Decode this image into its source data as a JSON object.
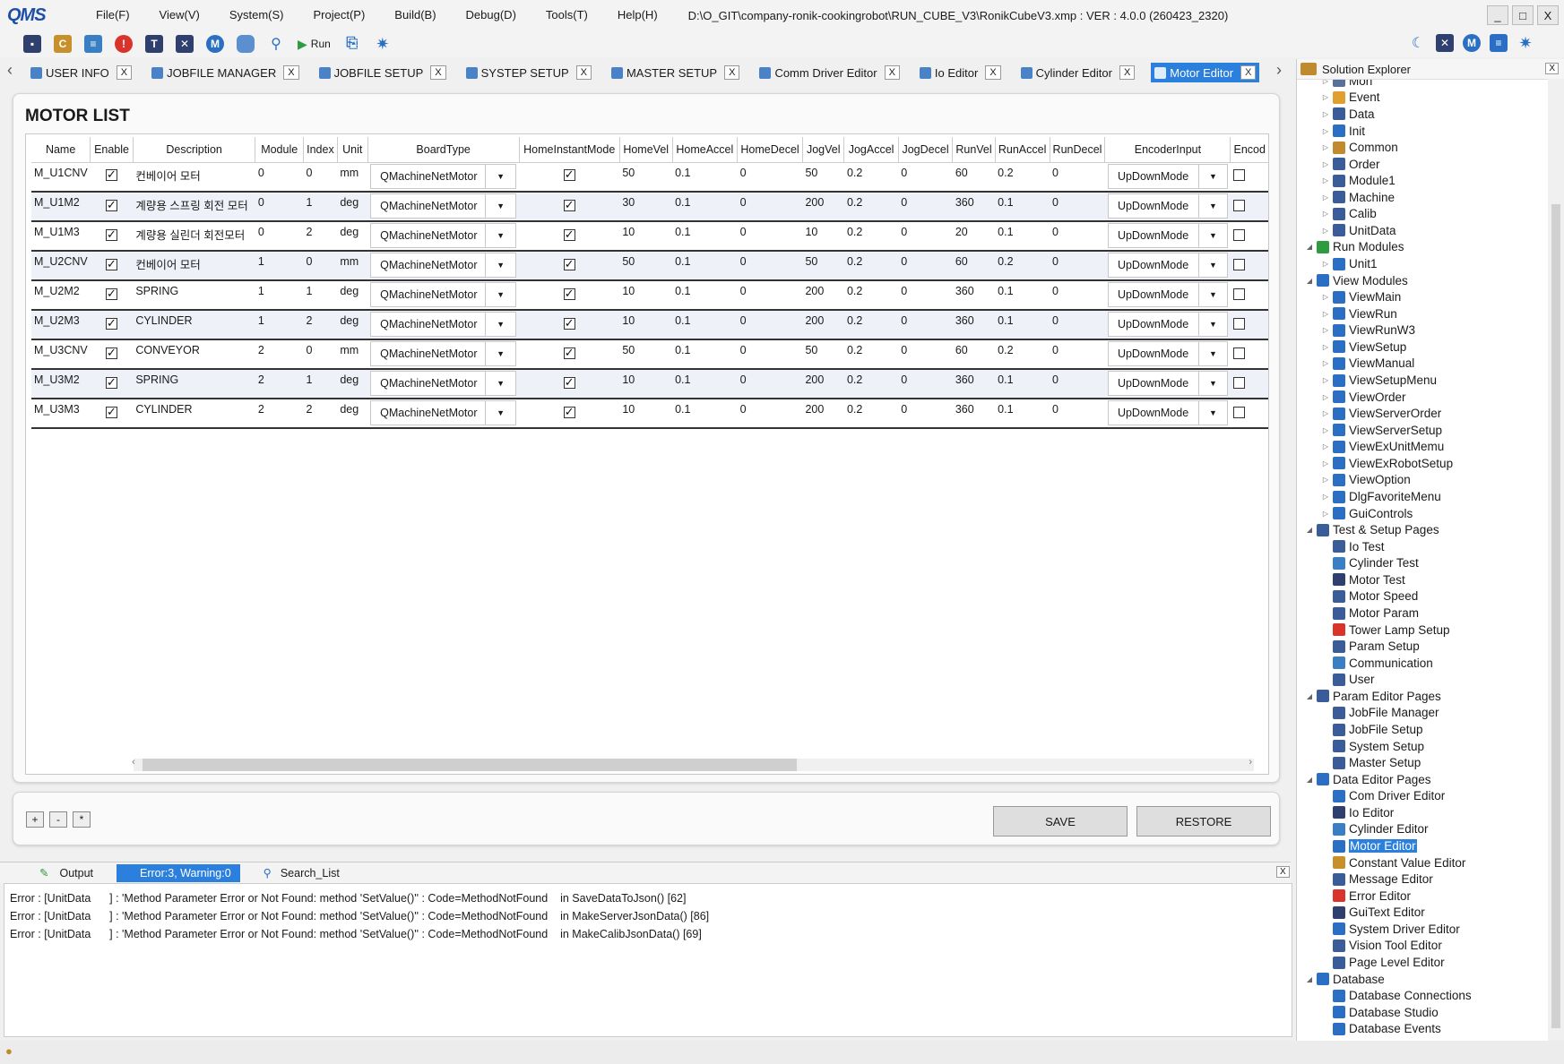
{
  "app": {
    "logo": "QMS",
    "file_path": "D:\\O_GIT\\company-ronik-cookingrobot\\RUN_CUBE_V3\\RonikCubeV3.xmp :  VER : 4.0.0 (260423_2320)",
    "menu": [
      "File(F)",
      "View(V)",
      "System(S)",
      "Project(P)",
      "Build(B)",
      "Debug(D)",
      "Tools(T)",
      "Help(H)"
    ],
    "window_controls": [
      "_",
      "□",
      "X"
    ]
  },
  "toolbar": {
    "run_label": "Run",
    "icons": [
      "save-icon",
      "c-icon",
      "message-icon",
      "error-icon",
      "text-icon",
      "cross-icon",
      "motor-icon",
      "database-icon",
      "search-icon",
      "run-icon",
      "page-icon",
      "gear-icon"
    ],
    "colors": {
      "accent": "#2b7fdd",
      "error": "#d9342b",
      "c_icon": "#c8902a"
    }
  },
  "tabs": [
    {
      "label": "USER INFO",
      "close": "X"
    },
    {
      "label": "JOBFILE MANAGER",
      "close": "X"
    },
    {
      "label": "JOBFILE SETUP",
      "close": "X"
    },
    {
      "label": "SYSTEP SETUP",
      "close": "X"
    },
    {
      "label": "MASTER SETUP",
      "close": "X"
    },
    {
      "label": "Comm Driver Editor",
      "close": "X"
    },
    {
      "label": "Io Editor",
      "close": "X"
    },
    {
      "label": "Cylinder Editor",
      "close": "X"
    },
    {
      "label": "Motor Editor",
      "close": "X",
      "active": true
    }
  ],
  "motor_list": {
    "title": "MOTOR LIST",
    "columns": [
      "Name",
      "Enable",
      "Description",
      "Module",
      "Index",
      "Unit",
      "BoardType",
      "HomeInstantMode",
      "HomeVel",
      "HomeAccel",
      "HomeDecel",
      "JogVel",
      "JogAccel",
      "JogDecel",
      "RunVel",
      "RunAccel",
      "RunDecel",
      "EncoderInput",
      "Encod"
    ],
    "rows": [
      {
        "name": "M_U1CNV",
        "enable": true,
        "desc": "컨베이어 모터",
        "module": "0",
        "index": "0",
        "unit": "mm",
        "board": "QMachineNetMotor",
        "home_instant": true,
        "home_vel": "50",
        "home_accel": "0.1",
        "home_decel": "0",
        "jog_vel": "50",
        "jog_accel": "0.2",
        "jog_decel": "0",
        "run_vel": "60",
        "run_accel": "0.2",
        "run_decel": "0",
        "encoder": "UpDownMode"
      },
      {
        "name": "M_U1M2",
        "enable": true,
        "desc": "계량용 스프링 회전 모터",
        "module": "0",
        "index": "1",
        "unit": "deg",
        "board": "QMachineNetMotor",
        "home_instant": true,
        "home_vel": "30",
        "home_accel": "0.1",
        "home_decel": "0",
        "jog_vel": "200",
        "jog_accel": "0.2",
        "jog_decel": "0",
        "run_vel": "360",
        "run_accel": "0.1",
        "run_decel": "0",
        "encoder": "UpDownMode"
      },
      {
        "name": "M_U1M3",
        "enable": true,
        "desc": "계량용 실린더 회전모터",
        "module": "0",
        "index": "2",
        "unit": "deg",
        "board": "QMachineNetMotor",
        "home_instant": true,
        "home_vel": "10",
        "home_accel": "0.1",
        "home_decel": "0",
        "jog_vel": "10",
        "jog_accel": "0.2",
        "jog_decel": "0",
        "run_vel": "20",
        "run_accel": "0.1",
        "run_decel": "0",
        "encoder": "UpDownMode"
      },
      {
        "name": "M_U2CNV",
        "enable": true,
        "desc": "컨베이어 모터",
        "module": "1",
        "index": "0",
        "unit": "mm",
        "board": "QMachineNetMotor",
        "home_instant": true,
        "home_vel": "50",
        "home_accel": "0.1",
        "home_decel": "0",
        "jog_vel": "50",
        "jog_accel": "0.2",
        "jog_decel": "0",
        "run_vel": "60",
        "run_accel": "0.2",
        "run_decel": "0",
        "encoder": "UpDownMode"
      },
      {
        "name": "M_U2M2",
        "enable": true,
        "desc": "SPRING",
        "module": "1",
        "index": "1",
        "unit": "deg",
        "board": "QMachineNetMotor",
        "home_instant": true,
        "home_vel": "10",
        "home_accel": "0.1",
        "home_decel": "0",
        "jog_vel": "200",
        "jog_accel": "0.2",
        "jog_decel": "0",
        "run_vel": "360",
        "run_accel": "0.1",
        "run_decel": "0",
        "encoder": "UpDownMode"
      },
      {
        "name": "M_U2M3",
        "enable": true,
        "desc": "CYLINDER",
        "module": "1",
        "index": "2",
        "unit": "deg",
        "board": "QMachineNetMotor",
        "home_instant": true,
        "home_vel": "10",
        "home_accel": "0.1",
        "home_decel": "0",
        "jog_vel": "200",
        "jog_accel": "0.2",
        "jog_decel": "0",
        "run_vel": "360",
        "run_accel": "0.1",
        "run_decel": "0",
        "encoder": "UpDownMode"
      },
      {
        "name": "M_U3CNV",
        "enable": true,
        "desc": "CONVEYOR",
        "module": "2",
        "index": "0",
        "unit": "mm",
        "board": "QMachineNetMotor",
        "home_instant": true,
        "home_vel": "50",
        "home_accel": "0.1",
        "home_decel": "0",
        "jog_vel": "50",
        "jog_accel": "0.2",
        "jog_decel": "0",
        "run_vel": "60",
        "run_accel": "0.2",
        "run_decel": "0",
        "encoder": "UpDownMode"
      },
      {
        "name": "M_U3M2",
        "enable": true,
        "desc": "SPRING",
        "module": "2",
        "index": "1",
        "unit": "deg",
        "board": "QMachineNetMotor",
        "home_instant": true,
        "home_vel": "10",
        "home_accel": "0.1",
        "home_decel": "0",
        "jog_vel": "200",
        "jog_accel": "0.2",
        "jog_decel": "0",
        "run_vel": "360",
        "run_accel": "0.1",
        "run_decel": "0",
        "encoder": "UpDownMode"
      },
      {
        "name": "M_U3M3",
        "enable": true,
        "desc": "CYLINDER",
        "module": "2",
        "index": "2",
        "unit": "deg",
        "board": "QMachineNetMotor",
        "home_instant": true,
        "home_vel": "10",
        "home_accel": "0.1",
        "home_decel": "0",
        "jog_vel": "200",
        "jog_accel": "0.2",
        "jog_decel": "0",
        "run_vel": "360",
        "run_accel": "0.1",
        "run_decel": "0",
        "encoder": "UpDownMode"
      }
    ]
  },
  "actions": {
    "add": "+",
    "remove": "-",
    "copy": "*",
    "save": "SAVE",
    "restore": "RESTORE"
  },
  "output": {
    "tabs": [
      "Output",
      "Error:3, Warning:0",
      "Search_List"
    ],
    "close": "X",
    "lines": [
      "Error : [UnitData      ] : 'Method Parameter Error or Not Found: method 'SetValue()'' : Code=MethodNotFound    in SaveDataToJson() [62]",
      "Error : [UnitData      ] : 'Method Parameter Error or Not Found: method 'SetValue()'' : Code=MethodNotFound    in MakeServerJsonData() [86]",
      "Error : [UnitData      ] : 'Method Parameter Error or Not Found: method 'SetValue()'' : Code=MethodNotFound    in MakeCalibJsonData() [69]"
    ]
  },
  "solution_explorer": {
    "title": "Solution Explorer",
    "close": "X",
    "nodes": [
      {
        "label": "Mon",
        "level": 1,
        "toggle": "▷",
        "icon": "#5a6f9a"
      },
      {
        "label": "Event",
        "level": 1,
        "toggle": "▷",
        "icon": "#e0a030"
      },
      {
        "label": "Data",
        "level": 1,
        "toggle": "▷",
        "icon": "#3a5d9a"
      },
      {
        "label": "Init",
        "level": 1,
        "toggle": "▷",
        "icon": "#2b6fc4"
      },
      {
        "label": "Common",
        "level": 1,
        "toggle": "▷",
        "icon": "#c08a2e"
      },
      {
        "label": "Order",
        "level": 1,
        "toggle": "▷",
        "icon": "#3a5d9a"
      },
      {
        "label": "Module1",
        "level": 1,
        "toggle": "▷",
        "icon": "#3a5d9a"
      },
      {
        "label": "Machine",
        "level": 1,
        "toggle": "▷",
        "icon": "#3a5d9a"
      },
      {
        "label": "Calib",
        "level": 1,
        "toggle": "▷",
        "icon": "#3a5d9a"
      },
      {
        "label": "UnitData",
        "level": 1,
        "toggle": "▷",
        "icon": "#3a5d9a"
      },
      {
        "label": "Run Modules",
        "level": 0,
        "toggle": "◢",
        "icon": "#2e9c3e"
      },
      {
        "label": "Unit1",
        "level": 1,
        "toggle": "▷",
        "icon": "#2b6fc4"
      },
      {
        "label": "View Modules",
        "level": 0,
        "toggle": "◢",
        "icon": "#2b6fc4"
      },
      {
        "label": "ViewMain",
        "level": 1,
        "toggle": "▷",
        "icon": "#2b6fc4"
      },
      {
        "label": "ViewRun",
        "level": 1,
        "toggle": "▷",
        "icon": "#2b6fc4"
      },
      {
        "label": "ViewRunW3",
        "level": 1,
        "toggle": "▷",
        "icon": "#2b6fc4"
      },
      {
        "label": "ViewSetup",
        "level": 1,
        "toggle": "▷",
        "icon": "#2b6fc4"
      },
      {
        "label": "ViewManual",
        "level": 1,
        "toggle": "▷",
        "icon": "#2b6fc4"
      },
      {
        "label": "ViewSetupMenu",
        "level": 1,
        "toggle": "▷",
        "icon": "#2b6fc4"
      },
      {
        "label": "ViewOrder",
        "level": 1,
        "toggle": "▷",
        "icon": "#2b6fc4"
      },
      {
        "label": "ViewServerOrder",
        "level": 1,
        "toggle": "▷",
        "icon": "#2b6fc4"
      },
      {
        "label": "ViewServerSetup",
        "level": 1,
        "toggle": "▷",
        "icon": "#2b6fc4"
      },
      {
        "label": "ViewExUnitMemu",
        "level": 1,
        "toggle": "▷",
        "icon": "#2b6fc4"
      },
      {
        "label": "ViewExRobotSetup",
        "level": 1,
        "toggle": "▷",
        "icon": "#2b6fc4"
      },
      {
        "label": "ViewOption",
        "level": 1,
        "toggle": "▷",
        "icon": "#2b6fc4"
      },
      {
        "label": "DlgFavoriteMenu",
        "level": 1,
        "toggle": "▷",
        "icon": "#2b6fc4"
      },
      {
        "label": "GuiControls",
        "level": 1,
        "toggle": "▷",
        "icon": "#2b6fc4"
      },
      {
        "label": "Test & Setup Pages",
        "level": 0,
        "toggle": "◢",
        "icon": "#3a5d9a"
      },
      {
        "label": "Io Test",
        "level": 1,
        "toggle": "",
        "icon": "#3a5d9a"
      },
      {
        "label": "Cylinder Test",
        "level": 1,
        "toggle": "",
        "icon": "#3a7fc4"
      },
      {
        "label": "Motor Test",
        "level": 1,
        "toggle": "",
        "icon": "#2f3f6e"
      },
      {
        "label": "Motor Speed",
        "level": 1,
        "toggle": "",
        "icon": "#3a5d9a"
      },
      {
        "label": "Motor Param",
        "level": 1,
        "toggle": "",
        "icon": "#3a5d9a"
      },
      {
        "label": "Tower Lamp Setup",
        "level": 1,
        "toggle": "",
        "icon": "#d9342b"
      },
      {
        "label": "Param Setup",
        "level": 1,
        "toggle": "",
        "icon": "#3a5d9a"
      },
      {
        "label": "Communication",
        "level": 1,
        "toggle": "",
        "icon": "#3a7fc4"
      },
      {
        "label": "User",
        "level": 1,
        "toggle": "",
        "icon": "#3a5d9a"
      },
      {
        "label": "Param Editor Pages",
        "level": 0,
        "toggle": "◢",
        "icon": "#3a5d9a"
      },
      {
        "label": "JobFile Manager",
        "level": 1,
        "toggle": "",
        "icon": "#3a5d9a"
      },
      {
        "label": "JobFile Setup",
        "level": 1,
        "toggle": "",
        "icon": "#3a5d9a"
      },
      {
        "label": "System Setup",
        "level": 1,
        "toggle": "",
        "icon": "#3a5d9a"
      },
      {
        "label": "Master Setup",
        "level": 1,
        "toggle": "",
        "icon": "#3a5d9a"
      },
      {
        "label": "Data Editor Pages",
        "level": 0,
        "toggle": "◢",
        "icon": "#2b6fc4"
      },
      {
        "label": "Com Driver Editor",
        "level": 1,
        "toggle": "",
        "icon": "#2b6fc4"
      },
      {
        "label": "Io Editor",
        "level": 1,
        "toggle": "",
        "icon": "#2f3f6e"
      },
      {
        "label": "Cylinder Editor",
        "level": 1,
        "toggle": "",
        "icon": "#3a7fc4"
      },
      {
        "label": "Motor Editor",
        "level": 1,
        "toggle": "",
        "icon": "#2b6fc4",
        "selected": true
      },
      {
        "label": "Constant Value Editor",
        "level": 1,
        "toggle": "",
        "icon": "#c8902a"
      },
      {
        "label": "Message Editor",
        "level": 1,
        "toggle": "",
        "icon": "#3a5d9a"
      },
      {
        "label": "Error Editor",
        "level": 1,
        "toggle": "",
        "icon": "#d9342b"
      },
      {
        "label": "GuiText Editor",
        "level": 1,
        "toggle": "",
        "icon": "#2f3f6e"
      },
      {
        "label": "System Driver Editor",
        "level": 1,
        "toggle": "",
        "icon": "#2b6fc4"
      },
      {
        "label": "Vision Tool Editor",
        "level": 1,
        "toggle": "",
        "icon": "#3a5d9a"
      },
      {
        "label": "Page Level Editor",
        "level": 1,
        "toggle": "",
        "icon": "#3a5d9a"
      },
      {
        "label": "Database",
        "level": 0,
        "toggle": "◢",
        "icon": "#2b6fc4"
      },
      {
        "label": "Database Connections",
        "level": 1,
        "toggle": "",
        "icon": "#2b6fc4"
      },
      {
        "label": "Database Studio",
        "level": 1,
        "toggle": "",
        "icon": "#2b6fc4"
      },
      {
        "label": "Database Events",
        "level": 1,
        "toggle": "",
        "icon": "#2b6fc4"
      }
    ]
  }
}
